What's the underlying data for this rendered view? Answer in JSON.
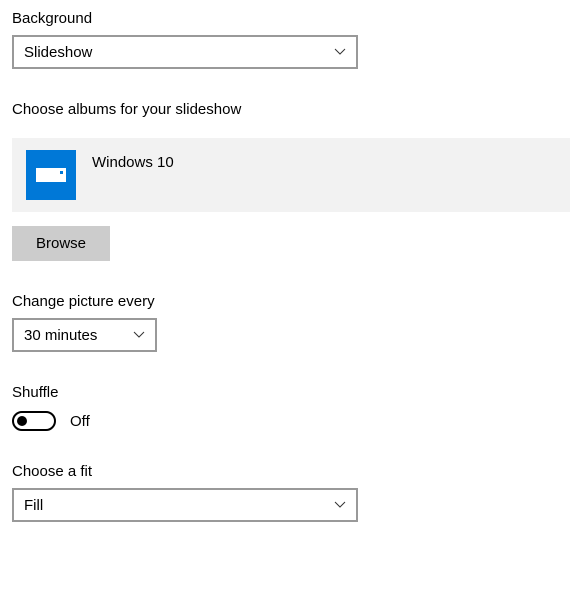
{
  "background": {
    "label": "Background",
    "value": "Slideshow"
  },
  "albums": {
    "label": "Choose albums for your slideshow",
    "item_name": "Windows 10",
    "browse_label": "Browse"
  },
  "interval": {
    "label": "Change picture every",
    "value": "30 minutes"
  },
  "shuffle": {
    "label": "Shuffle",
    "state_label": "Off"
  },
  "fit": {
    "label": "Choose a fit",
    "value": "Fill"
  }
}
